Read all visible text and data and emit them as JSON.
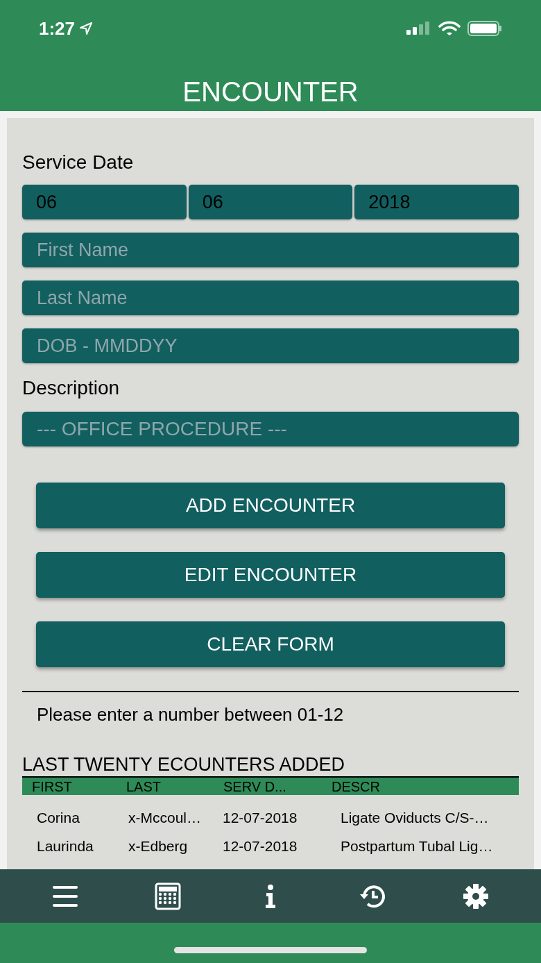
{
  "status_bar": {
    "time": "1:27"
  },
  "title": "ENCOUNTER",
  "service_date": {
    "label": "Service Date",
    "fields": [
      {
        "value": "06"
      },
      {
        "value": "06"
      },
      {
        "value": "2018"
      }
    ]
  },
  "fields": [
    {
      "placeholder": "First Name"
    },
    {
      "placeholder": "Last Name"
    },
    {
      "placeholder": "DOB - MMDDYY"
    }
  ],
  "description": {
    "label": "Description",
    "value": "--- OFFICE PROCEDURE ---"
  },
  "buttons": [
    "ADD ENCOUNTER",
    "EDIT ENCOUNTER",
    "CLEAR FORM"
  ],
  "message": "Please enter a number between 01-12",
  "table": {
    "title": "LAST TWENTY ECOUNTERS ADDED",
    "columns": [
      "FIRST",
      "LAST",
      "SERV D...",
      "DESCR"
    ],
    "rows": [
      [
        "Corina",
        "x-Mccoul…",
        "12-07-2018",
        "Ligate Oviducts C/S-…"
      ],
      [
        "Laurinda",
        "x-Edberg",
        "12-07-2018",
        "Postpartum Tubal Lig…"
      ]
    ]
  },
  "tab_bar": [
    {
      "kind": "menu"
    },
    {
      "kind": "calculator"
    },
    {
      "kind": "info"
    },
    {
      "kind": "history"
    },
    {
      "kind": "settings"
    }
  ]
}
